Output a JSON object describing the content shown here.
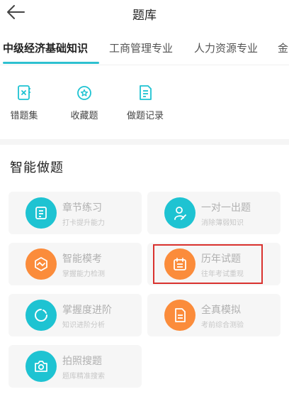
{
  "header": {
    "title": "题库",
    "back_icon": "arrow-left-icon"
  },
  "tabs": [
    {
      "label": "中级经济基础知识",
      "active": true
    },
    {
      "label": "工商管理专业",
      "active": false
    },
    {
      "label": "人力资源专业",
      "active": false
    },
    {
      "label": "金",
      "active": false
    }
  ],
  "quick_actions": [
    {
      "label": "错题集",
      "icon": "error-book-icon"
    },
    {
      "label": "收藏题",
      "icon": "star-badge-icon"
    },
    {
      "label": "做题记录",
      "icon": "record-document-icon"
    }
  ],
  "section": {
    "title": "智能做题"
  },
  "cards": [
    {
      "title": "章节练习",
      "subtitle": "打卡提升能力",
      "icon": "document-list-icon",
      "color": "#1ec3d2"
    },
    {
      "title": "一对一出题",
      "subtitle": "消除薄弱知识",
      "icon": "person-edit-icon",
      "color": "#1ec3d2"
    },
    {
      "title": "智能模考",
      "subtitle": "掌握能力检测",
      "icon": "hexagon-wave-icon",
      "color": "#fb8c3b"
    },
    {
      "title": "历年试题",
      "subtitle": "往年考试重现",
      "icon": "calendar-icon",
      "color": "#fb8c3b"
    },
    {
      "title": "掌握度进阶",
      "subtitle": "知识进阶分析",
      "icon": "progress-ring-icon",
      "color": "#1ec3d2"
    },
    {
      "title": "全真模拟",
      "subtitle": "考前综合测验",
      "icon": "exam-paper-icon",
      "color": "#fb8c3b"
    },
    {
      "title": "拍照搜题",
      "subtitle": "题库精准搜索",
      "icon": "camera-icon",
      "color": "#1ec3d2"
    }
  ],
  "colors": {
    "accent": "#2ec0d0",
    "teal": "#1ec3d2",
    "orange": "#fb8c3b",
    "highlight": "#d9322f"
  }
}
